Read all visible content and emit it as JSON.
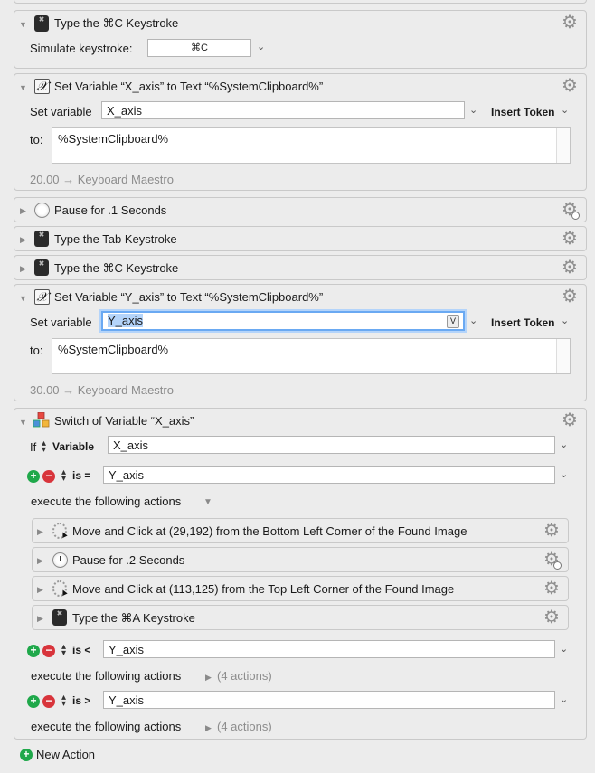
{
  "blocks": {
    "type_cmd_c_1": {
      "title": "Type the ⌘C Keystroke",
      "simulate_label": "Simulate keystroke:",
      "keystroke_value": "⌘C"
    },
    "set_x": {
      "title": "Set Variable “X_axis” to Text “%SystemClipboard%”",
      "set_variable_label": "Set variable",
      "variable_value": "X_axis",
      "insert_token_label": "Insert Token",
      "to_label": "to:",
      "text_value": "%SystemClipboard%",
      "footer": "20.00 → Keyboard Maestro"
    },
    "pause_1": {
      "title": "Pause for .1 Seconds"
    },
    "type_tab": {
      "title": "Type the Tab Keystroke"
    },
    "type_cmd_c_2": {
      "title": "Type the ⌘C Keystroke"
    },
    "set_y": {
      "title": "Set Variable “Y_axis” to Text “%SystemClipboard%”",
      "set_variable_label": "Set variable",
      "variable_value": "Y_axis",
      "var_badge": "V",
      "insert_token_label": "Insert Token",
      "to_label": "to:",
      "text_value": "%SystemClipboard%",
      "footer": "30.00 → Keyboard Maestro"
    },
    "switch": {
      "title": "Switch of Variable “X_axis”",
      "if_label": "If",
      "variable_label": "Variable",
      "variable_value": "X_axis",
      "cases": [
        {
          "op": "is =",
          "value": "Y_axis",
          "execute_label": "execute the following actions",
          "actions_count": ""
        },
        {
          "op": "is <",
          "value": "Y_axis",
          "execute_label": "execute the following actions",
          "actions_count": "(4 actions)"
        },
        {
          "op": "is >",
          "value": "Y_axis",
          "execute_label": "execute the following actions",
          "actions_count": "(4 actions)"
        }
      ],
      "sub_actions": [
        "Move and Click at (29,192) from the Bottom Left Corner of the Found Image",
        "Pause for .2 Seconds",
        "Move and Click at (113,125) from the Top Left Corner of the Found Image",
        "Type the ⌘A Keystroke"
      ]
    }
  },
  "new_action_label": "New Action",
  "icons": {
    "gear": "gear-icon",
    "keyboard": "keyboard-icon",
    "variable": "variable-icon",
    "clock": "clock-icon",
    "mouse": "mouse-click-icon",
    "switch": "switch-icon",
    "plus": "plus-circle-icon",
    "minus": "minus-circle-icon"
  },
  "colors": {
    "plus": "#1fa84a",
    "minus": "#d8343b",
    "selection": "#b4d4fa",
    "focus": "#6aa9f2"
  }
}
